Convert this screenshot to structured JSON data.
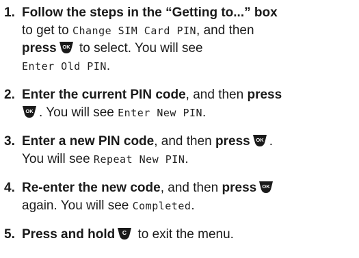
{
  "steps": [
    {
      "number": "1.",
      "bold1": "Follow the steps in the “Getting to...” box",
      "text1": " to get to ",
      "screen1": "Change SIM Card PIN",
      "text2": ", and then ",
      "bold2": "press",
      "key": "OK",
      "text3": " to select. You will see",
      "screen2": "Enter Old PIN",
      "text4": "."
    },
    {
      "number": "2.",
      "bold1": "Enter the current PIN code",
      "text1": ", and then ",
      "bold2": "press",
      "key": "OK",
      "text2": ". You will see ",
      "screen": "Enter New PIN",
      "text3": "."
    },
    {
      "number": "3.",
      "bold1": "Enter a new PIN code",
      "text1": ", and then ",
      "bold2": "press",
      "key": "OK",
      "text2": ".",
      "text3": "You will see ",
      "screen": "Repeat New PIN",
      "text4": "."
    },
    {
      "number": "4.",
      "bold1": "Re-enter the new code",
      "text1": ", and then ",
      "bold2": "press",
      "key": "OK",
      "text2": "again. You will see ",
      "screen": "Completed",
      "text3": "."
    },
    {
      "number": "5.",
      "bold1": "Press and hold",
      "key": "C",
      "text1": " to exit the menu."
    }
  ],
  "colors": {
    "text": "#1a1a1a",
    "key_fill": "#1a1a1a",
    "key_label": "#ffffff"
  },
  "icons": {
    "ok_key": "ok-key-icon",
    "clear_key": "clear-key-icon"
  }
}
